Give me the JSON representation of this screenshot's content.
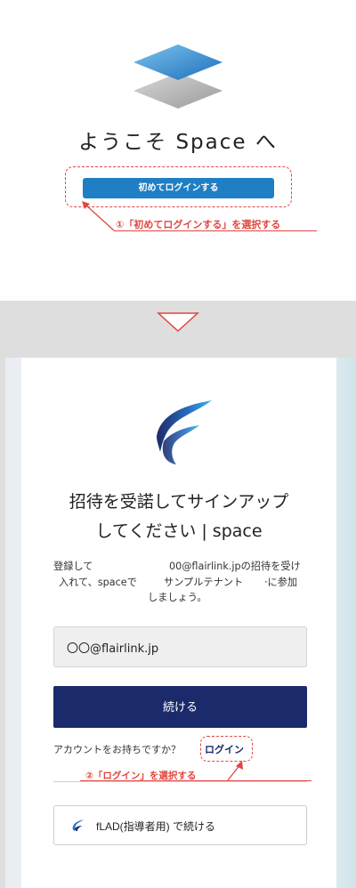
{
  "top": {
    "welcome_title": "ようこそ Space へ",
    "first_login_button": "初めてログインする",
    "callout": "①「初めてログインする」を選択する"
  },
  "signup": {
    "heading_line1": "招待を受諾してサインアップ",
    "heading_line2": "してください | space",
    "desc_line1_a": "登録して",
    "desc_line1_b": "00@flairlink.jpの招待を受け",
    "desc_line2_a": "入れて、spaceで",
    "desc_line2_b": "サンプルテナント",
    "desc_line2_c": "·に参加",
    "desc_line3": "しましょう。",
    "email_value": "〇〇@flairlink.jp",
    "continue_button": "続ける",
    "account_prompt": "アカウントをお持ちですか？",
    "login_link": "ログイン",
    "callout": "②「ログイン」を選択する",
    "flad_button": "fLAD(指導者用) で続ける"
  },
  "colors": {
    "accent_red": "#e0463f",
    "primary_blue": "#1f7fc4",
    "navy": "#1b2a6b"
  },
  "icons": [
    "space-logo-icon",
    "down-arrow-icon",
    "flairlink-logo-icon",
    "flad-logo-icon"
  ]
}
